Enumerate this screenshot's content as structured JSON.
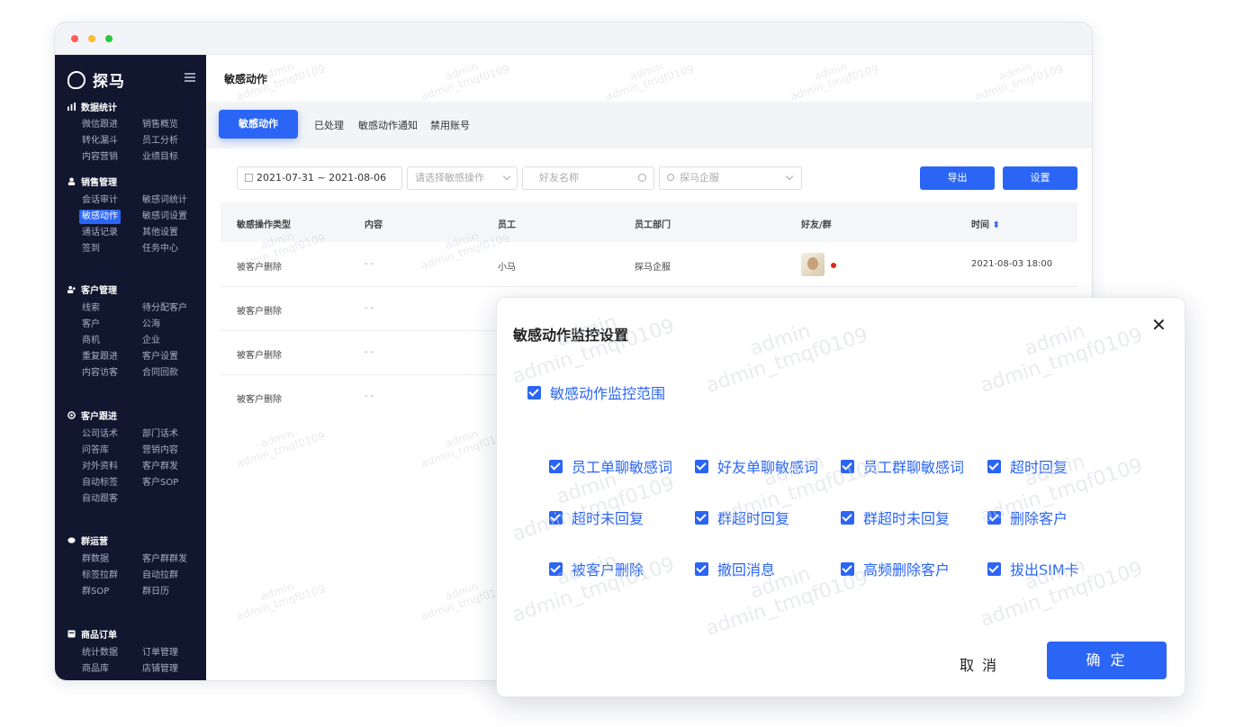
{
  "app": {
    "name": "探马"
  },
  "sidebar": {
    "sections": [
      {
        "title": "数据统计",
        "items": [
          "微信跟进",
          "销售概览",
          "转化漏斗",
          "员工分析",
          "内容营销",
          "业绩目标"
        ]
      },
      {
        "title": "销售管理",
        "items": [
          "会话审计",
          "敏感词统计",
          "敏感动作",
          "敏感词设置",
          "通话记录",
          "其他设置",
          "签到",
          "任务中心"
        ]
      },
      {
        "title": "客户管理",
        "items": [
          "线索",
          "待分配客户",
          "客户",
          "公海",
          "商机",
          "企业",
          "重复跟进",
          "客户设置",
          "内容访客",
          "合同回款"
        ]
      },
      {
        "title": "客户跟进",
        "items": [
          "公司话术",
          "部门话术",
          "问答库",
          "营销内容",
          "对外资料",
          "客户群发",
          "自动标签",
          "客户SOP",
          "自动跟客"
        ]
      },
      {
        "title": "群运营",
        "items": [
          "群数据",
          "客户群群发",
          "标签拉群",
          "自动拉群",
          "群SOP",
          "群日历"
        ]
      },
      {
        "title": "商品订单",
        "items": [
          "统计数据",
          "订单管理",
          "商品库",
          "店铺管理"
        ]
      }
    ]
  },
  "page": {
    "title": "敏感动作"
  },
  "tabs": [
    "敏感动作",
    "已处理",
    "敏感动作通知",
    "禁用账号"
  ],
  "filters": {
    "date_range": "2021-07-31 ~ 2021-08-06",
    "action_placeholder": "请选择敏感操作",
    "friend_placeholder": "好友名称",
    "employee_placeholder": "探马企服",
    "export_label": "导出",
    "settings_label": "设置"
  },
  "table": {
    "columns": [
      "敏感操作类型",
      "内容",
      "员工",
      "员工部门",
      "好友/群",
      "时间"
    ],
    "rows": [
      {
        "type": "被客户删除",
        "content": "- -",
        "employee": "小马",
        "department": "探马企服",
        "time": "2021-08-03 18:00"
      },
      {
        "type": "被客户删除",
        "content": "- -"
      },
      {
        "type": "被客户删除",
        "content": "- -"
      },
      {
        "type": "被客户删除",
        "content": "- -"
      }
    ]
  },
  "modal": {
    "title": "敏感动作监控设置",
    "scope_label": "敏感动作监控范围",
    "options": [
      "员工单聊敏感词",
      "好友单聊敏感词",
      "员工群聊敏感词",
      "超时回复",
      "超时未回复",
      "群超时回复",
      "群超时未回复",
      "删除客户",
      "被客户删除",
      "撤回消息",
      "高频删除客户",
      "拔出SIM卡"
    ],
    "cancel_label": "取 消",
    "confirm_label": "确 定"
  },
  "watermark": {
    "line1": "admin",
    "line2": "admin_tmqf0109"
  },
  "colors": {
    "accent": "#2b65f5",
    "sidebar_bg": "#11172f"
  }
}
